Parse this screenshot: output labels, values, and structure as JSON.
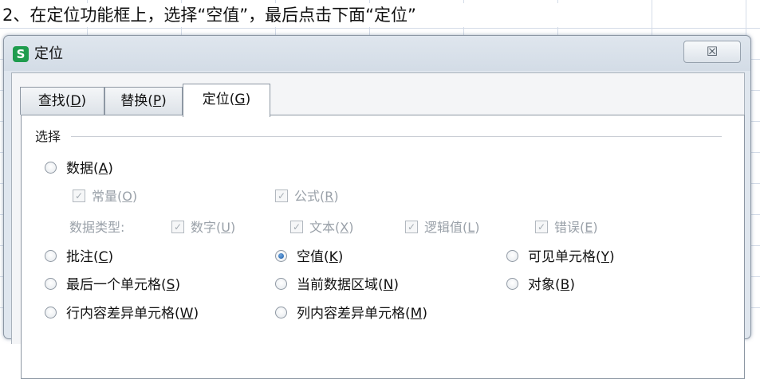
{
  "instruction": "2、在定位功能框上，选择“空值”，最后点击下面“定位”",
  "dialog": {
    "title": "定位",
    "app_icon_glyph": "S",
    "close_glyph": "☒",
    "tabs": [
      {
        "label": "查找",
        "key": "D",
        "active": false
      },
      {
        "label": "替换",
        "key": "P",
        "active": false
      },
      {
        "label": "定位",
        "key": "G",
        "active": true
      }
    ],
    "group_label": "选择",
    "options": {
      "data": {
        "label": "数据",
        "key": "A",
        "checked": false
      },
      "constants": {
        "label": "常量",
        "key": "O",
        "checked": true,
        "enabled": false
      },
      "formulas": {
        "label": "公式",
        "key": "R",
        "checked": true,
        "enabled": false
      },
      "data_type_label": "数据类型:",
      "number": {
        "label": "数字",
        "key": "U",
        "checked": true,
        "enabled": false
      },
      "text": {
        "label": "文本",
        "key": "X",
        "checked": true,
        "enabled": false
      },
      "logical": {
        "label": "逻辑值",
        "key": "L",
        "checked": true,
        "enabled": false
      },
      "error": {
        "label": "错误",
        "key": "E",
        "checked": true,
        "enabled": false
      },
      "comments": {
        "label": "批注",
        "key": "C",
        "checked": false
      },
      "blanks": {
        "label": "空值",
        "key": "K",
        "checked": true
      },
      "visible_cells": {
        "label": "可见单元格",
        "key": "Y",
        "checked": false
      },
      "last_cell": {
        "label": "最后一个单元格",
        "key": "S",
        "checked": false
      },
      "current_region": {
        "label": "当前数据区域",
        "key": "N",
        "checked": false
      },
      "objects": {
        "label": "对象",
        "key": "B",
        "checked": false
      },
      "row_differences": {
        "label": "行内容差异单元格",
        "key": "W",
        "checked": false
      },
      "column_differences": {
        "label": "列内容差异单元格",
        "key": "M",
        "checked": false
      }
    }
  },
  "colors": {
    "accent_radio": "#1c5ea8",
    "app_icon": "#1f9c4e",
    "dialog_bg": "#dfe6ee"
  }
}
